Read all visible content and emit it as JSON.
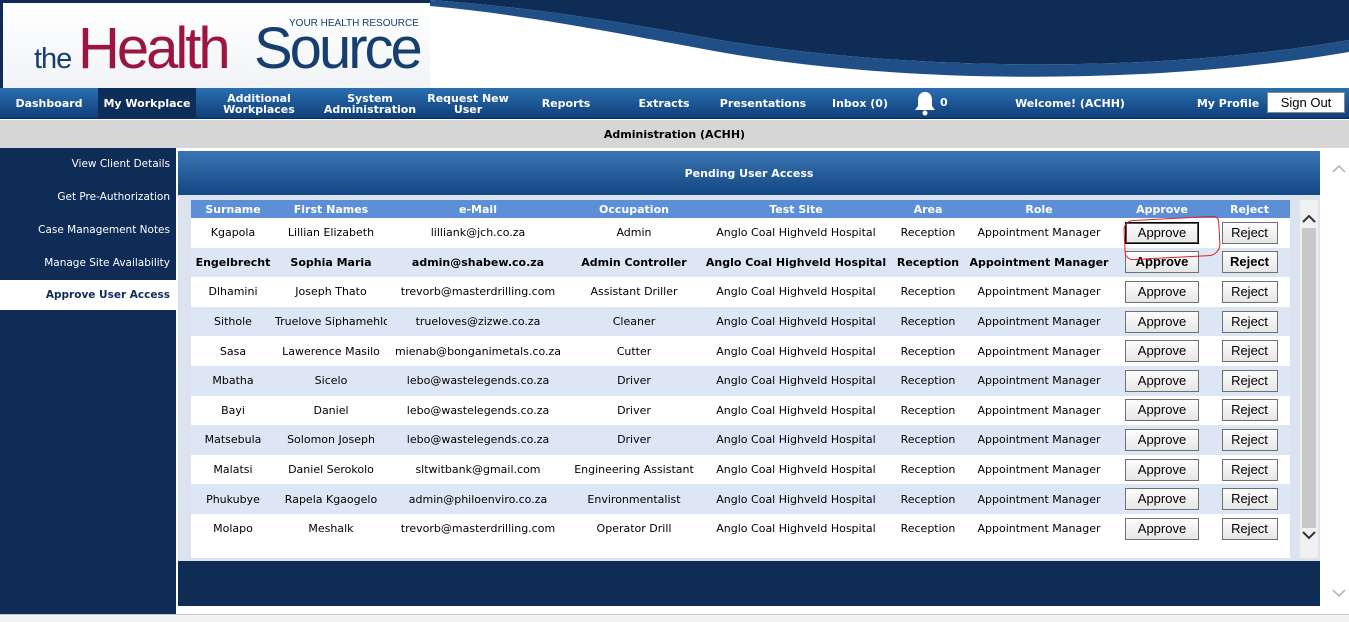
{
  "logo": {
    "the": "the",
    "health": "Health",
    "source": "Source",
    "tagline": "YOUR HEALTH RESOURCE"
  },
  "nav": {
    "items": [
      {
        "label": "Dashboard"
      },
      {
        "label": "My Workplace",
        "active": true
      },
      {
        "label": "Additional Workplaces"
      },
      {
        "label": "System Administration"
      },
      {
        "label": "Request New User"
      },
      {
        "label": "Reports"
      },
      {
        "label": "Extracts"
      },
      {
        "label": "Presentations"
      },
      {
        "label": "Inbox (0)"
      }
    ],
    "notification_count": "0",
    "welcome": "Welcome! (ACHH)",
    "my_profile": "My Profile",
    "sign_out": "Sign Out"
  },
  "subheader": "Administration (ACHH)",
  "sidebar": {
    "items": [
      {
        "label": "View Client Details"
      },
      {
        "label": "Get Pre-Authorization"
      },
      {
        "label": "Case Management Notes"
      },
      {
        "label": "Manage Site Availability"
      },
      {
        "label": "Approve User Access",
        "active": true
      }
    ]
  },
  "panel": {
    "title": "Pending User Access"
  },
  "table": {
    "columns": [
      "Surname",
      "First Names",
      "e-Mail",
      "Occupation",
      "Test Site",
      "Area",
      "Role",
      "Approve",
      "Reject"
    ],
    "approve_label": "Approve",
    "reject_label": "Reject",
    "rows": [
      {
        "surname": "Kgapola",
        "first": "Lillian Elizabeth",
        "email": "lilliank@jch.co.za",
        "occupation": "Admin",
        "site": "Anglo Coal Highveld Hospital",
        "area": "Reception",
        "role": "Appointment Manager"
      },
      {
        "surname": "Engelbrecht",
        "first": "Sophia Maria",
        "email": "admin@shabew.co.za",
        "occupation": "Admin Controller",
        "site": "Anglo Coal Highveld Hospital",
        "area": "Reception",
        "role": "Appointment Manager"
      },
      {
        "surname": "Dlhamini",
        "first": "Joseph Thato",
        "email": "trevorb@masterdrilling.com",
        "occupation": "Assistant Driller",
        "site": "Anglo Coal Highveld Hospital",
        "area": "Reception",
        "role": "Appointment Manager"
      },
      {
        "surname": "Sithole",
        "first": "Truelove Siphamehlo",
        "email": "trueloves@zizwe.co.za",
        "occupation": "Cleaner",
        "site": "Anglo Coal Highveld Hospital",
        "area": "Reception",
        "role": "Appointment Manager"
      },
      {
        "surname": "Sasa",
        "first": "Lawerence Masilo",
        "email": "mienab@bonganimetals.co.za",
        "occupation": "Cutter",
        "site": "Anglo Coal Highveld Hospital",
        "area": "Reception",
        "role": "Appointment Manager"
      },
      {
        "surname": "Mbatha",
        "first": "Sicelo",
        "email": "lebo@wastelegends.co.za",
        "occupation": "Driver",
        "site": "Anglo Coal Highveld Hospital",
        "area": "Reception",
        "role": "Appointment Manager"
      },
      {
        "surname": "Bayi",
        "first": "Daniel",
        "email": "lebo@wastelegends.co.za",
        "occupation": "Driver",
        "site": "Anglo Coal Highveld Hospital",
        "area": "Reception",
        "role": "Appointment Manager"
      },
      {
        "surname": "Matsebula",
        "first": "Solomon Joseph",
        "email": "lebo@wastelegends.co.za",
        "occupation": "Driver",
        "site": "Anglo Coal Highveld Hospital",
        "area": "Reception",
        "role": "Appointment Manager"
      },
      {
        "surname": "Malatsi",
        "first": "Daniel Serokolo",
        "email": "sltwitbank@gmail.com",
        "occupation": "Engineering Assistant",
        "site": "Anglo Coal Highveld Hospital",
        "area": "Reception",
        "role": "Appointment Manager"
      },
      {
        "surname": "Phukubye",
        "first": "Rapela Kgaogelo",
        "email": "admin@philoenviro.co.za",
        "occupation": "Environmentalist",
        "site": "Anglo Coal Highveld Hospital",
        "area": "Reception",
        "role": "Appointment Manager"
      },
      {
        "surname": "Molapo",
        "first": "Meshalk",
        "email": "trevorb@masterdrilling.com",
        "occupation": "Operator Drill",
        "site": "Anglo Coal Highveld Hospital",
        "area": "Reception",
        "role": "Appointment Manager"
      }
    ]
  },
  "colors": {
    "navy": "#0f2c57",
    "nav_blue": "#1d5a9a",
    "header_row": "#5c8fd6",
    "logo_red": "#9c1540",
    "highlight": "#e02020"
  }
}
